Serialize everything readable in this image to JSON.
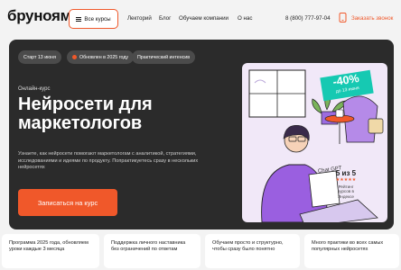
{
  "header": {
    "logo": "бруноям",
    "courses_button": "Все курсы",
    "nav": [
      {
        "label": "Лекторий",
        "key": "lectorium"
      },
      {
        "label": "Блог",
        "key": "blog"
      },
      {
        "label": "Обучаем компании",
        "key": "companies"
      },
      {
        "label": "О нас",
        "key": "about"
      }
    ],
    "phone": "8 (800) 777-97-04",
    "callback": "Заказать звонок"
  },
  "hero": {
    "chips": [
      "Старт 13 июня",
      "Обновлен в 2025 году",
      "Практический интенсив"
    ],
    "kicker": "Онлайн-курс",
    "title": "Нейросети для маркетологов",
    "description": "Узнаете, как нейросети помогают маркетологам с аналитикой, стратегиями, исследованиями и идеями по продукту. Попрактикуетесь сразу в нескольких нейросетях",
    "cta": "Записаться на курс",
    "discount": "-40%",
    "discount_note": "до 13 июня",
    "note_text": "Chat GPT",
    "rating_score": "5 из 5",
    "rating_stars": "★★★★★",
    "rating_caption": "Рейтинг курсов в Яндексе"
  },
  "features": [
    "Программа 2025 года, обновляем уроки каждые 3 месяца",
    "Поддержка личного наставника без ограничений по ответам",
    "Обучаем просто и структурно, чтобы сразу было понятно",
    "Много практики во всех самых популярных нейросетях"
  ],
  "colors": {
    "accent": "#f0582a",
    "hero_bg": "#2b2b2b",
    "sale_badge": "#16c9b2",
    "illustration_bg": "#f1e8f8"
  }
}
